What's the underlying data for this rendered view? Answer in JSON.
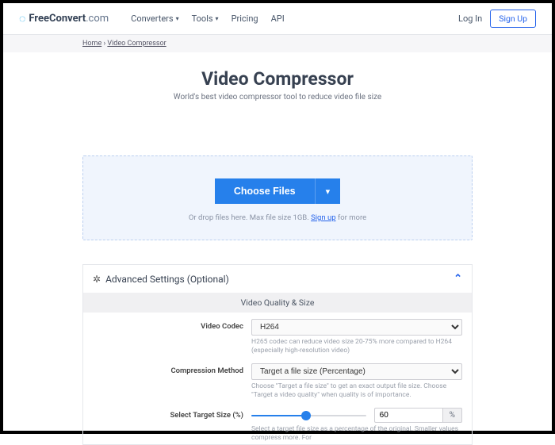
{
  "header": {
    "logo_bold": "FreeConvert",
    "logo_light": ".com",
    "nav": {
      "converters": "Converters",
      "tools": "Tools",
      "pricing": "Pricing",
      "api": "API"
    },
    "login": "Log In",
    "signup": "Sign Up"
  },
  "breadcrumb": {
    "home": "Home",
    "sep": " › ",
    "current": "Video Compressor"
  },
  "hero": {
    "title": "Video Compressor",
    "subtitle": "World's best video compressor tool to reduce video file size"
  },
  "drop": {
    "choose": "Choose Files",
    "hint_pre": "Or drop files here. Max file size 1GB. ",
    "signup": "Sign up",
    "hint_post": " for more"
  },
  "panel": {
    "title": "Advanced Settings (Optional)",
    "section": "Video Quality & Size",
    "codec": {
      "label": "Video Codec",
      "value": "H264",
      "help": "H265 codec can reduce video size 20-75% more compared to H264 (especially high-resolution video)"
    },
    "method": {
      "label": "Compression Method",
      "value": "Target a file size (Percentage)",
      "help": "Choose \"Target a file size\" to get an exact output file size. Choose \"Target a video quality\" when quality is of importance."
    },
    "target": {
      "label": "Select Target Size (%)",
      "value": "60",
      "unit": "%",
      "help": "Select a target file size as a percentage of the original. Smaller values compress more. For"
    }
  }
}
